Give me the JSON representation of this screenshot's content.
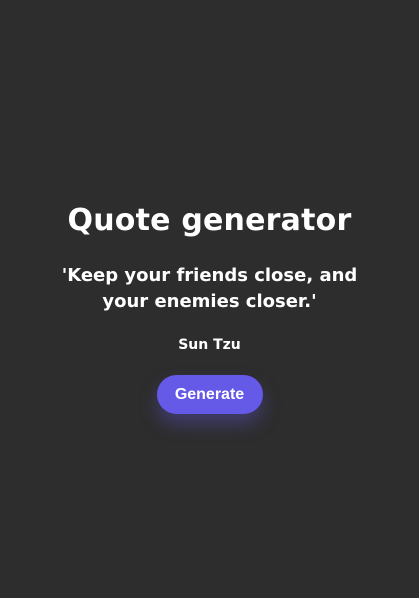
{
  "app": {
    "title": "Quote generator",
    "quote": "'Keep your friends close, and your enemies closer.'",
    "author": "Sun Tzu",
    "generate_label": "Generate"
  },
  "colors": {
    "background": "#2d2d2d",
    "text": "#ffffff",
    "accent": "#6559e8"
  }
}
